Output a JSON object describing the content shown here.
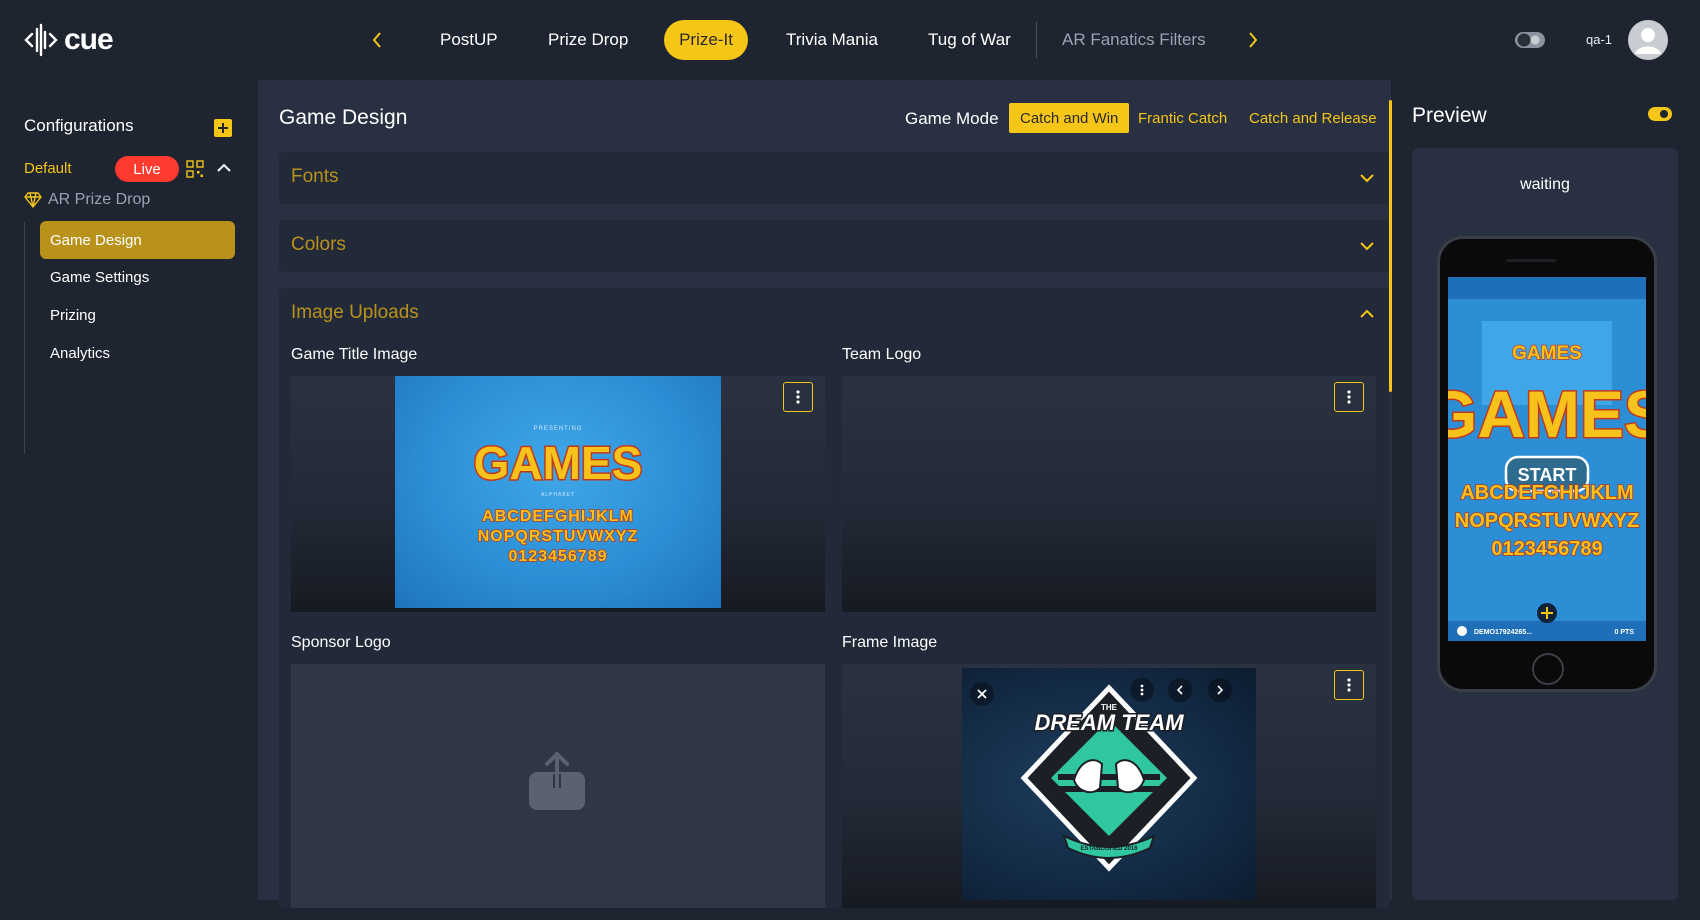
{
  "app": {
    "logo_text": "cue"
  },
  "nav": {
    "tabs": [
      {
        "label": "PostUP"
      },
      {
        "label": "Prize Drop"
      },
      {
        "label": "Prize-It"
      },
      {
        "label": "Trivia Mania"
      },
      {
        "label": "Tug of War"
      },
      {
        "label": "AR Fanatics Filters"
      }
    ],
    "active_tab": "Prize-It"
  },
  "user": {
    "name": "qa-1"
  },
  "sidebar": {
    "title": "Configurations",
    "default_label": "Default",
    "live_badge": "Live",
    "experience": "AR Prize Drop",
    "items": [
      {
        "label": "Game Design",
        "active": true
      },
      {
        "label": "Game Settings",
        "active": false
      },
      {
        "label": "Prizing",
        "active": false
      },
      {
        "label": "Analytics",
        "active": false
      }
    ]
  },
  "main": {
    "title": "Game Design",
    "game_mode_label": "Game Mode",
    "modes": [
      {
        "label": "Catch and Win",
        "active": true
      },
      {
        "label": "Frantic Catch",
        "active": false
      },
      {
        "label": "Catch and Release",
        "active": false
      }
    ],
    "sections": [
      {
        "title": "Fonts",
        "expanded": false
      },
      {
        "title": "Colors",
        "expanded": false
      },
      {
        "title": "Image Uploads",
        "expanded": true
      }
    ],
    "uploads": [
      {
        "label": "Game Title Image"
      },
      {
        "label": "Team Logo"
      },
      {
        "label": "Sponsor Logo"
      },
      {
        "label": "Frame Image"
      }
    ]
  },
  "art": {
    "games": {
      "presenting": "PRESENTING",
      "title": "GAMES",
      "alphabet": "ALPHABET",
      "row1": "ABCDEFGHIJKLM",
      "row2": "NOPQRSTUVWXYZ",
      "row3": "0123456789"
    },
    "dream": {
      "the": "THE",
      "title": "DREAM TEAM",
      "ribbon": "ESTABLISHED 2016"
    }
  },
  "preview": {
    "title": "Preview",
    "status": "waiting",
    "start_label": "START",
    "footer_id": "DEMO17924265...",
    "footer_pts": "0 PTS"
  },
  "colors": {
    "accent": "#f5c518",
    "live": "#ff3b30",
    "panel": "#283041",
    "background": "#1e2430"
  }
}
